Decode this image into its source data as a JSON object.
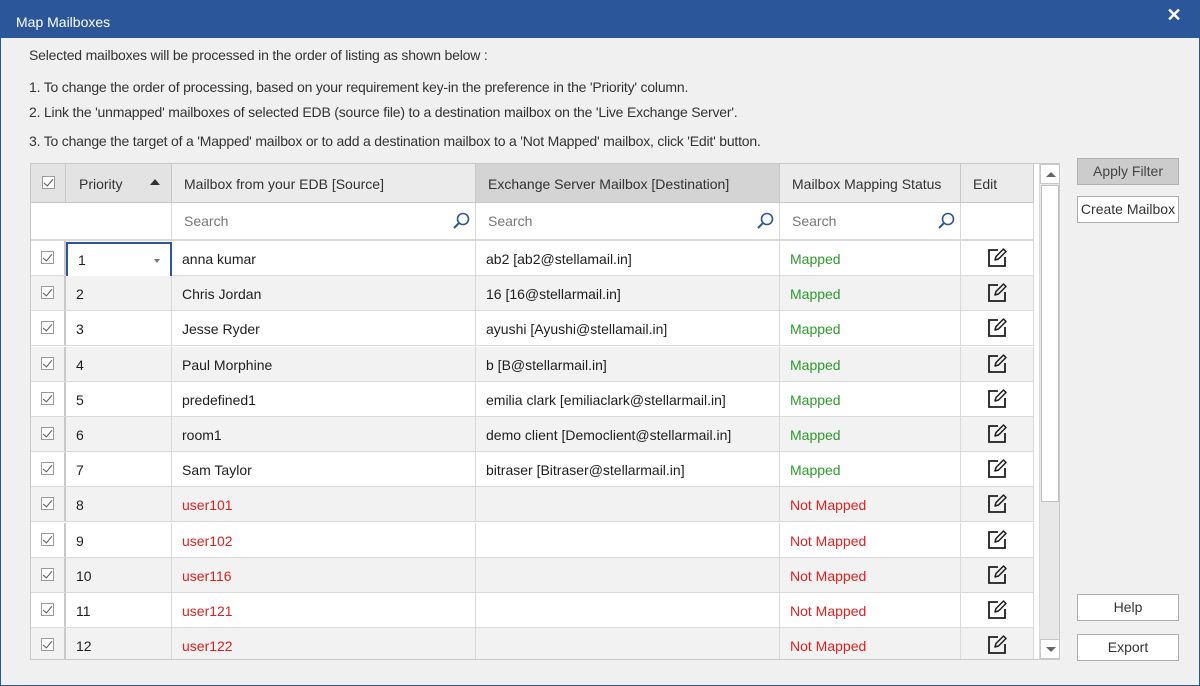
{
  "window": {
    "title": "Map Mailboxes",
    "close_icon": "close-icon"
  },
  "instructions": {
    "intro": "Selected mailboxes will be processed in the order of listing as shown below :",
    "step1": "1. To change the order of processing, based on your requirement key-in the preference in the 'Priority' column.",
    "step2": "2. Link the 'unmapped' mailboxes of selected EDB (source file) to a destination mailbox on the 'Live Exchange Server'.",
    "step3": "3. To change the target of a 'Mapped' mailbox or to add a destination mailbox to a 'Not Mapped' mailbox, click 'Edit' button."
  },
  "grid": {
    "columns": {
      "select_all": true,
      "priority": "Priority",
      "priority_sort": "ascending",
      "source": "Mailbox from your EDB [Source]",
      "destination": "Exchange Server Mailbox [Destination]",
      "status": "Mailbox Mapping Status",
      "edit": "Edit"
    },
    "search": {
      "source_placeholder": "Search",
      "destination_placeholder": "Search",
      "status_placeholder": "Search"
    },
    "status_colors": {
      "mapped": "#2a9d2a",
      "not_mapped": "#e02020"
    },
    "rows": [
      {
        "checked": true,
        "priority": "1",
        "source": "anna kumar",
        "destination": "ab2 [ab2@stellamail.in]",
        "status": "Mapped",
        "mapped": true,
        "editing": true
      },
      {
        "checked": true,
        "priority": "2",
        "source": "Chris Jordan",
        "destination": "16 [16@stellarmail.in]",
        "status": "Mapped",
        "mapped": true
      },
      {
        "checked": true,
        "priority": "3",
        "source": "Jesse Ryder",
        "destination": "ayushi [Ayushi@stellamail.in]",
        "status": "Mapped",
        "mapped": true
      },
      {
        "checked": true,
        "priority": "4",
        "source": "Paul Morphine",
        "destination": "b [B@stellarmail.in]",
        "status": "Mapped",
        "mapped": true
      },
      {
        "checked": true,
        "priority": "5",
        "source": "predefined1",
        "destination": "emilia clark [emiliaclark@stellarmail.in]",
        "status": "Mapped",
        "mapped": true
      },
      {
        "checked": true,
        "priority": "6",
        "source": "room1",
        "destination": "demo client [Democlient@stellarmail.in]",
        "status": "Mapped",
        "mapped": true
      },
      {
        "checked": true,
        "priority": "7",
        "source": "Sam Taylor",
        "destination": "bitraser [Bitraser@stellarmail.in]",
        "status": "Mapped",
        "mapped": true
      },
      {
        "checked": true,
        "priority": "8",
        "source": "user101",
        "destination": "",
        "status": "Not Mapped",
        "mapped": false
      },
      {
        "checked": true,
        "priority": "9",
        "source": "user102",
        "destination": "",
        "status": "Not Mapped",
        "mapped": false
      },
      {
        "checked": true,
        "priority": "10",
        "source": "user116",
        "destination": "",
        "status": "Not Mapped",
        "mapped": false
      },
      {
        "checked": true,
        "priority": "11",
        "source": "user121",
        "destination": "",
        "status": "Not Mapped",
        "mapped": false
      },
      {
        "checked": true,
        "priority": "12",
        "source": "user122",
        "destination": "",
        "status": "Not Mapped",
        "mapped": false
      }
    ]
  },
  "buttons": {
    "apply_filter": "Apply Filter",
    "create_mailbox": "Create Mailbox",
    "help": "Help",
    "export": "Export"
  }
}
